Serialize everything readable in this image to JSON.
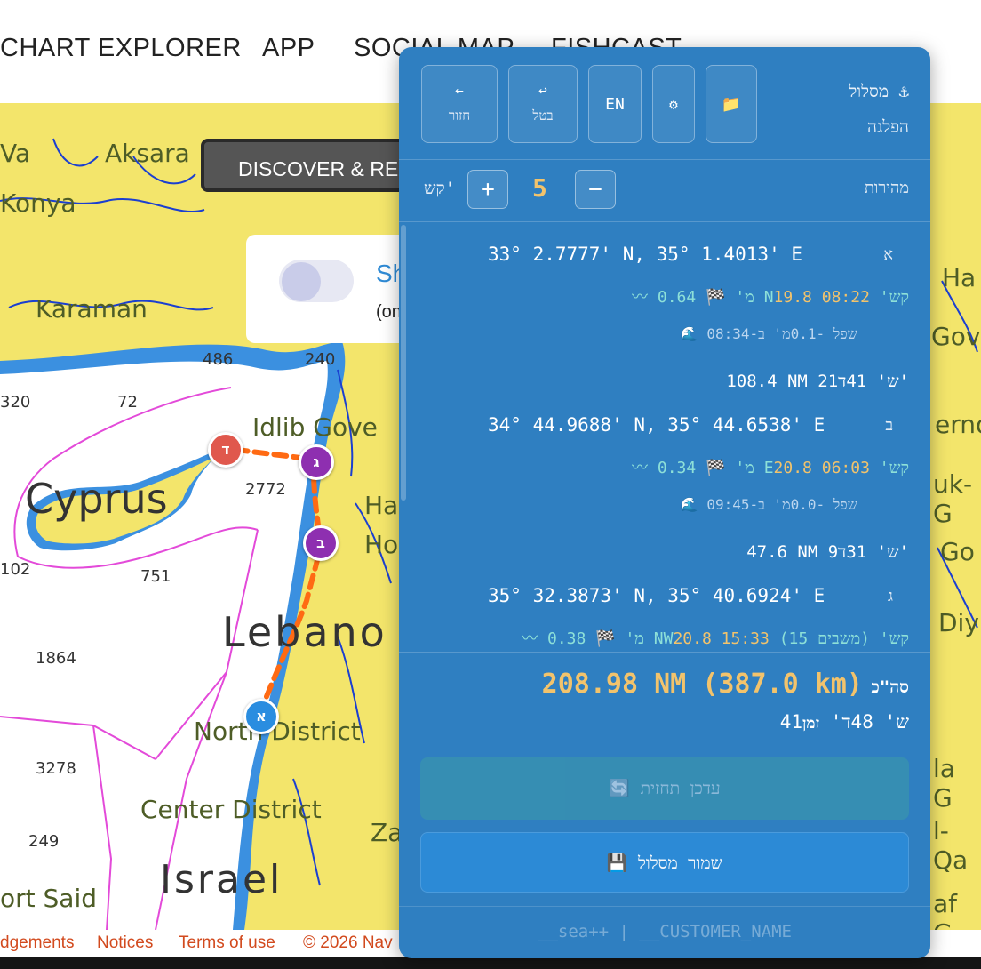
{
  "nav": {
    "items": [
      "CHART EXPLORER",
      "APP",
      "SOCIAL MAP",
      "FISHCAST"
    ]
  },
  "map": {
    "discover_label": "DISCOVER & RE",
    "popup": {
      "title": "Sh",
      "subtitle": "(on"
    },
    "places": {
      "aksara": "Aksara",
      "konya": "Konya",
      "karaman": "Karaman",
      "idlib": "Idlib Gove",
      "cyprus": "Cyprus",
      "lebanon": "Lebano",
      "north_district": "North District",
      "center_district": "Center District",
      "israel": "Israel",
      "port_said": "ort Said",
      "ha": "Ha",
      "ho": "Ho",
      "za": "Za",
      "right_va": "Va",
      "right_ha": "Ha",
      "right_gov": "Gov",
      "right_erno": "erno",
      "right_uk": "uk-G",
      "right_go": "Go",
      "right_diy": "Diy",
      "right_la": "la G",
      "right_lqa": "l-Qa",
      "right_af": "af G"
    },
    "depths": [
      "320",
      "72",
      "486",
      "240",
      "2772",
      "102",
      "751",
      "1864",
      "3278",
      "249"
    ],
    "markers": {
      "a": "א",
      "b": "ב",
      "g": "ג",
      "d": "ד"
    }
  },
  "footer": {
    "items": [
      "dgements",
      "Notices",
      "Terms of use",
      "© 2026 Nav"
    ]
  },
  "panel": {
    "title_line1": "⚓ מסלול",
    "title_line2": "הפלגה",
    "buttons": {
      "back": {
        "icon": "←",
        "label": "חזור"
      },
      "undo": {
        "icon": "↩",
        "label": "בטל"
      },
      "lang": {
        "label": "EN"
      },
      "settings": {
        "icon": "⚙"
      },
      "folder": {
        "icon": "📁"
      }
    },
    "speed": {
      "label": "מהירות",
      "value": "5",
      "unit": "קש'",
      "minus": "−",
      "plus": "+"
    },
    "waypoints": [
      {
        "letter": "א",
        "coord": "33° 2.7777' N, 35° 1.4013' E",
        "wx_temp": "19.8",
        "wx_time": "08:22",
        "wx_wind": "🏁 4 Nקש'",
        "wx_wave": "〰 0.6מ'",
        "tide": "🌊 שפל -0.1מ' ב-08:34",
        "leg": "108.4 NM 21ש' 41ד'"
      },
      {
        "letter": "ב",
        "coord": "34° 44.9688' N, 35° 44.6538' E",
        "wx_temp": "20.8",
        "wx_time": "06:03",
        "wx_wind": "🏁 4 Eקש'",
        "wx_wave": "〰 0.3מ'",
        "tide": "🌊 שפל -0.0מ' ב-09:45",
        "leg": "47.6 NM 9ש' 31ד'"
      },
      {
        "letter": "ג",
        "coord": "35° 32.3873' N, 35° 40.6924' E",
        "wx_temp": "20.8",
        "wx_time": "15:33",
        "wx_wind": "🏁 8 NWקש' (משבים 15)",
        "wx_wave": "〰 0.3מ'"
      }
    ],
    "total": {
      "label": "סה\"כ",
      "value": "208.98 NM (387.0 km)"
    },
    "time": {
      "label": "זמן",
      "value": "41ש' 48ד'"
    },
    "refresh_label": "🔄 עדכן תחזית",
    "save_label": "💾 שמור מסלול",
    "brand": "__sea++ | __CUSTOMER_NAME",
    "colors": {
      "panel": "#2f7fc1",
      "accent": "#f2c36c",
      "teal": "#8de0d8"
    }
  }
}
